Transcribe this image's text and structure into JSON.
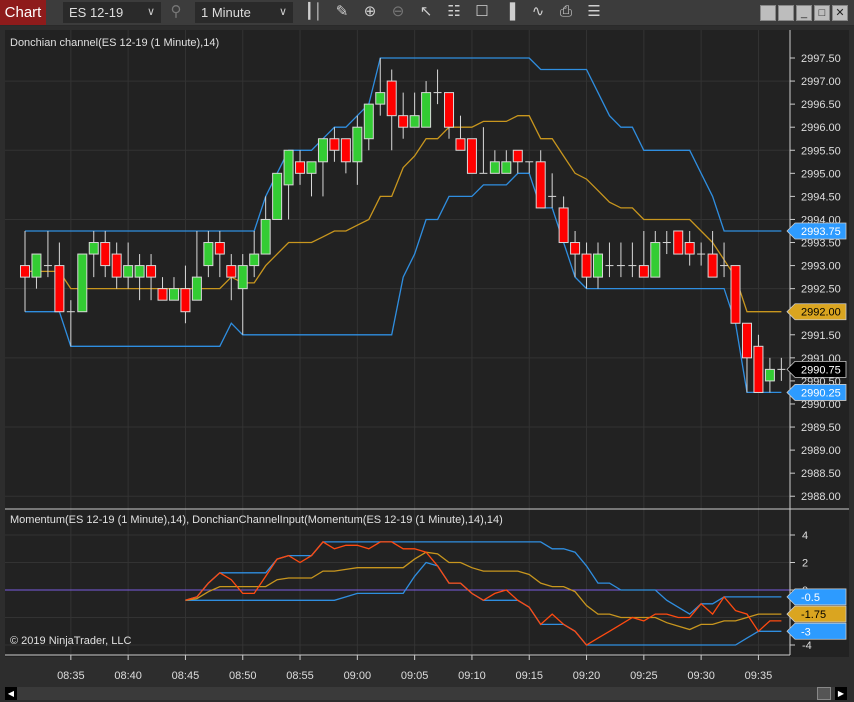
{
  "toolbar": {
    "chart_label": "Chart",
    "instrument": "ES 12-19",
    "interval": "1 Minute",
    "icons": [
      "bar-type-icon",
      "pencil-icon",
      "zoom-in-icon",
      "zoom-out-icon",
      "pointer-icon",
      "data-box-icon",
      "properties-icon",
      "indicators-icon",
      "strategies-icon",
      "templates-icon",
      "list-icon"
    ],
    "window_buttons": [
      "tile-icon",
      "tile-icon",
      "minimize-icon",
      "maximize-icon",
      "close-icon"
    ]
  },
  "panels": {
    "price_title": "Donchian channel(ES 12-19 (1 Minute),14)",
    "momentum_title": "Momentum(ES 12-19 (1 Minute),14), DonchianChannelInput(Momentum(ES 12-19 (1 Minute),14),14)",
    "copyright": "© 2019 NinjaTrader, LLC"
  },
  "colors": {
    "background": "#222222",
    "up": "#33cc33",
    "down": "#ff0000",
    "wick": "#d8d8d8",
    "channel_outer": "#2f8ee0",
    "channel_mid": "#c8961e",
    "momentum": "#ff4a10",
    "zero_line": "#7b5ce0",
    "last_price_bg": "#000000",
    "upper_label_bg": "#2d9bff",
    "mid_label_bg": "#daa520"
  },
  "chart_data": [
    {
      "type": "candlestick",
      "title": "Donchian channel(ES 12-19 (1 Minute),14)",
      "period": 14,
      "ylim": [
        2988.0,
        2997.5
      ],
      "y_ticks": [
        "2988.00",
        "2988.50",
        "2989.00",
        "2989.50",
        "2990.00",
        "2990.50",
        "2991.00",
        "2991.50",
        "2992.00",
        "2992.50",
        "2993.00",
        "2993.50",
        "2994.00",
        "2994.50",
        "2995.00",
        "2995.50",
        "2996.00",
        "2996.50",
        "2997.00",
        "2997.50"
      ],
      "x_ticks": [
        "08:35",
        "08:40",
        "08:45",
        "08:50",
        "08:55",
        "09:00",
        "09:05",
        "09:10",
        "09:15",
        "09:20",
        "09:25",
        "09:30",
        "09:35"
      ],
      "start_time": "08:31",
      "end_time": "09:37",
      "grid": true,
      "ohlc": [
        [
          2993.0,
          2993.75,
          2992.0,
          2992.75
        ],
        [
          2992.75,
          2993.25,
          2992.5,
          2993.25
        ],
        [
          2993.0,
          2993.75,
          2992.75,
          2993.0
        ],
        [
          2993.0,
          2993.5,
          2992.0,
          2992.0
        ],
        [
          2992.0,
          2992.25,
          2991.25,
          2992.0
        ],
        [
          2992.0,
          2993.25,
          2992.0,
          2993.25
        ],
        [
          2993.25,
          2993.75,
          2992.75,
          2993.5
        ],
        [
          2993.5,
          2993.75,
          2992.75,
          2993.0
        ],
        [
          2993.25,
          2993.5,
          2992.5,
          2992.75
        ],
        [
          2992.75,
          2993.5,
          2992.5,
          2993.0
        ],
        [
          2992.75,
          2993.25,
          2992.25,
          2993.0
        ],
        [
          2993.0,
          2993.25,
          2992.25,
          2992.75
        ],
        [
          2992.5,
          2992.75,
          2992.25,
          2992.25
        ],
        [
          2992.25,
          2992.75,
          2992.25,
          2992.5
        ],
        [
          2992.5,
          2993.0,
          2991.75,
          2992.0
        ],
        [
          2992.25,
          2993.75,
          2992.25,
          2992.75
        ],
        [
          2993.0,
          2993.75,
          2992.75,
          2993.5
        ],
        [
          2993.5,
          2993.75,
          2992.75,
          2993.25
        ],
        [
          2993.0,
          2993.25,
          2992.25,
          2992.75
        ],
        [
          2992.5,
          2993.25,
          2991.5,
          2993.0
        ],
        [
          2993.0,
          2993.75,
          2992.75,
          2993.25
        ],
        [
          2993.25,
          2994.5,
          2993.25,
          2994.0
        ],
        [
          2994.0,
          2995.0,
          2994.0,
          2995.0
        ],
        [
          2994.75,
          2995.5,
          2994.0,
          2995.5
        ],
        [
          2995.25,
          2995.5,
          2994.75,
          2995.0
        ],
        [
          2995.0,
          2995.25,
          2994.5,
          2995.25
        ],
        [
          2995.25,
          2995.75,
          2994.5,
          2995.75
        ],
        [
          2995.75,
          2996.0,
          2995.25,
          2995.5
        ],
        [
          2995.75,
          2995.75,
          2995.0,
          2995.25
        ],
        [
          2995.25,
          2996.25,
          2994.75,
          2996.0
        ],
        [
          2995.75,
          2996.5,
          2995.5,
          2996.5
        ],
        [
          2996.5,
          2997.5,
          2996.25,
          2996.75
        ],
        [
          2997.0,
          2997.25,
          2995.5,
          2996.25
        ],
        [
          2996.25,
          2996.75,
          2995.75,
          2996.0
        ],
        [
          2996.0,
          2996.75,
          2996.0,
          2996.25
        ],
        [
          2996.0,
          2997.0,
          2996.0,
          2996.75
        ],
        [
          2996.75,
          2997.25,
          2996.5,
          2996.75
        ],
        [
          2996.75,
          2996.75,
          2995.75,
          2996.0
        ],
        [
          2995.75,
          2996.25,
          2995.5,
          2995.5
        ],
        [
          2995.75,
          2995.75,
          2995.0,
          2995.0
        ],
        [
          2995.0,
          2996.0,
          2995.0,
          2995.0
        ],
        [
          2995.0,
          2995.5,
          2995.0,
          2995.25
        ],
        [
          2995.0,
          2995.5,
          2995.0,
          2995.25
        ],
        [
          2995.5,
          2995.5,
          2995.0,
          2995.25
        ],
        [
          2995.25,
          2995.25,
          2995.0,
          2995.25
        ],
        [
          2995.25,
          2995.5,
          2994.25,
          2994.25
        ],
        [
          2994.5,
          2995.0,
          2994.25,
          2994.5
        ],
        [
          2994.25,
          2994.5,
          2993.5,
          2993.5
        ],
        [
          2993.5,
          2993.75,
          2992.75,
          2993.25
        ],
        [
          2993.25,
          2993.5,
          2992.5,
          2992.75
        ],
        [
          2992.75,
          2993.5,
          2992.5,
          2993.25
        ],
        [
          2993.0,
          2993.5,
          2992.75,
          2993.0
        ],
        [
          2993.0,
          2993.5,
          2992.75,
          2993.0
        ],
        [
          2993.0,
          2993.5,
          2992.75,
          2993.0
        ],
        [
          2993.0,
          2993.75,
          2992.75,
          2992.75
        ],
        [
          2992.75,
          2993.75,
          2992.75,
          2993.5
        ],
        [
          2993.5,
          2993.75,
          2993.25,
          2993.5
        ],
        [
          2993.75,
          2993.75,
          2993.25,
          2993.25
        ],
        [
          2993.5,
          2993.75,
          2993.0,
          2993.25
        ],
        [
          2993.25,
          2993.5,
          2993.0,
          2993.25
        ],
        [
          2993.25,
          2993.75,
          2992.75,
          2992.75
        ],
        [
          2993.0,
          2993.5,
          2992.75,
          2993.0
        ],
        [
          2993.0,
          2993.0,
          2991.75,
          2991.75
        ],
        [
          2991.75,
          2991.75,
          2990.25,
          2991.0
        ],
        [
          2991.25,
          2991.5,
          2990.25,
          2990.25
        ],
        [
          2990.5,
          2991.0,
          2990.25,
          2990.75
        ],
        [
          2990.75,
          2991.0,
          2990.5,
          2990.75
        ]
      ],
      "last_values": {
        "upper": "2993.75",
        "last_price": "2990.75",
        "mid": "2992.00",
        "lower": "2990.25"
      }
    },
    {
      "type": "line",
      "title": "Momentum(ES 12-19 (1 Minute),14), DonchianChannelInput(Momentum(ES 12-19 (1 Minute),14),14)",
      "ylim": [
        -5,
        5
      ],
      "y_ticks": [
        "4",
        "2",
        "0",
        "-2",
        "-4"
      ],
      "last_values": {
        "upper": "-0.5",
        "mid": "-1.75",
        "lower": "-3"
      }
    }
  ]
}
